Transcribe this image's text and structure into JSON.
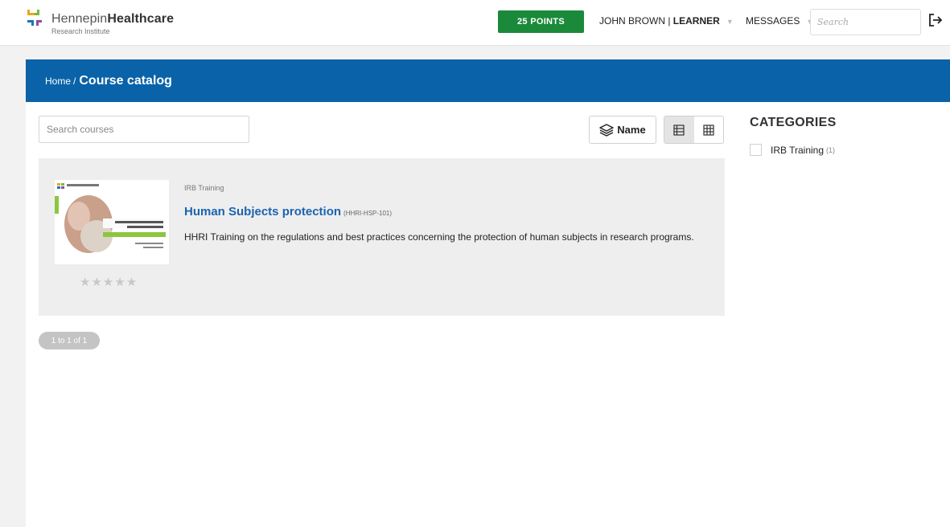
{
  "header": {
    "logo_name_light": "Hennepin",
    "logo_name_bold": "Healthcare",
    "logo_sub": "Research Institute",
    "points_label": "25 POINTS",
    "user_name": "JOHN BROWN",
    "user_separator": " | ",
    "user_role": "LEARNER",
    "messages_label": "MESSAGES",
    "search_placeholder": "Search"
  },
  "breadcrumb": {
    "home": "Home",
    "separator": "/",
    "current": "Course catalog"
  },
  "toolbar": {
    "search_placeholder": "Search courses",
    "sort_label": "Name"
  },
  "course": {
    "category": "IRB Training",
    "title": "Human Subjects protection",
    "code": "(HHRI-HSP-101)",
    "description": "HHRI Training on the regulations and best practices concerning the protection of human subjects in research programs.",
    "rating_stars": "★★★★★",
    "rating_value": 0,
    "thumbnail": {
      "brand": "Hennepin Healthcare",
      "title": "Human Subjects Research Training"
    }
  },
  "pagination": {
    "label": "1 to 1 of 1"
  },
  "sidebar": {
    "title": "CATEGORIES",
    "items": [
      {
        "label": "IRB Training",
        "count": "(1)"
      }
    ]
  },
  "colors": {
    "brand_blue": "#0a63a8",
    "points_green": "#1a8a3a",
    "link_blue": "#1a64b0"
  }
}
